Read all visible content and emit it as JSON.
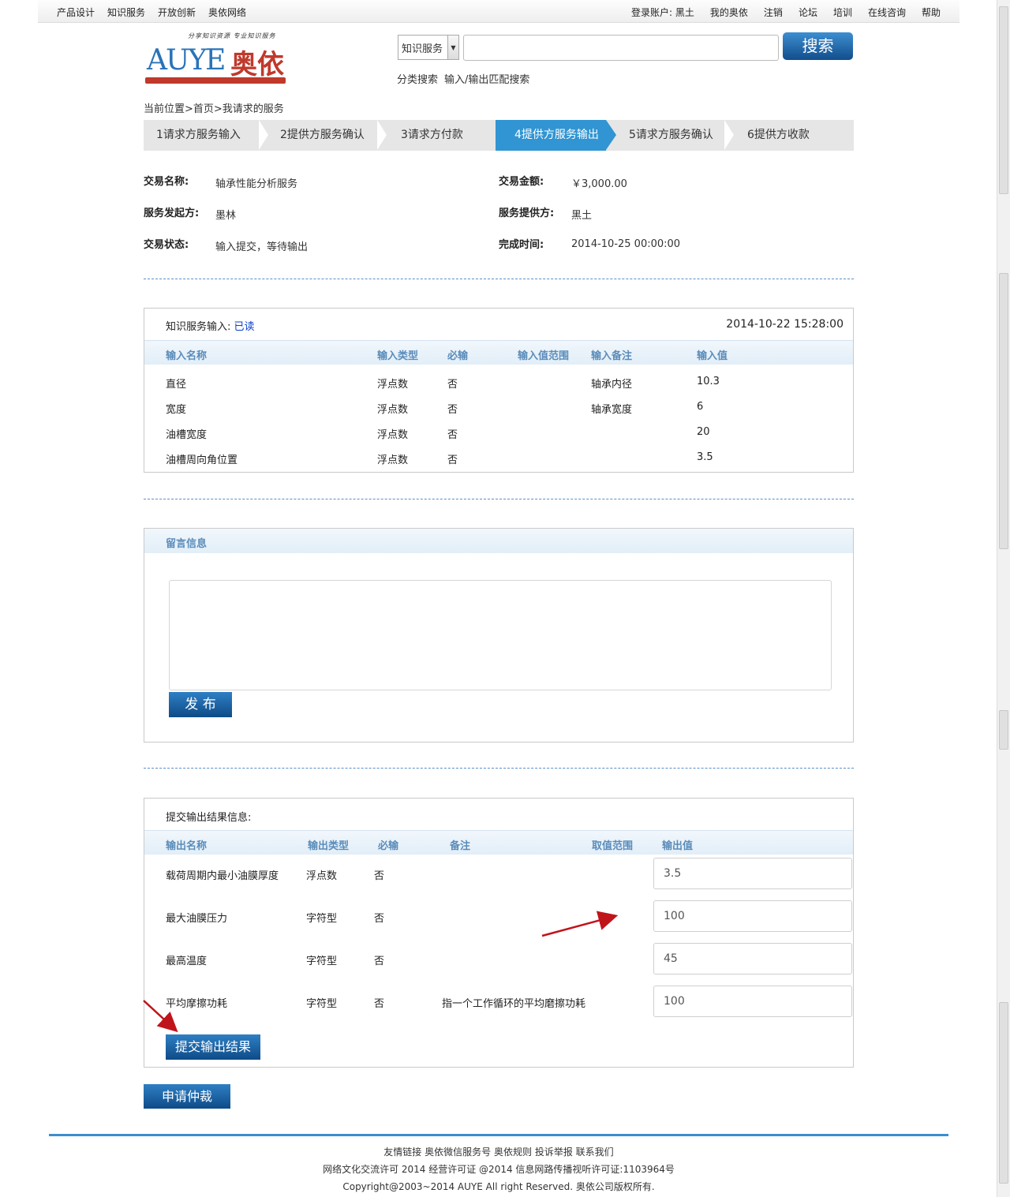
{
  "topnav": {
    "left": [
      "产品设计",
      "知识服务",
      "开放创新",
      "奥依网络"
    ],
    "account_label": "登录账户:",
    "account_name": "黑土",
    "right": [
      "我的奥依",
      "注销",
      "论坛",
      "培训",
      "在线咨询",
      "帮助"
    ]
  },
  "logo": {
    "tagline": "分享知识资源 专业知识服务",
    "brand": "AUYE",
    "brand_cn": "奥依"
  },
  "search": {
    "category": "知识服务",
    "button": "搜索",
    "links": [
      "分类搜索",
      "输入/输出匹配搜索"
    ]
  },
  "breadcrumb": "当前位置>首页>我请求的服务",
  "steps": [
    "1请求方服务输入",
    "2提供方服务确认",
    "3请求方付款",
    "4提供方服务输出",
    "5请求方服务确认",
    "6提供方收款"
  ],
  "active_step": 3,
  "transaction": {
    "name_label": "交易名称:",
    "name": "轴承性能分析服务",
    "amount_label": "交易金额:",
    "amount": "￥3,000.00",
    "initiator_label": "服务发起方:",
    "initiator": "墨林",
    "provider_label": "服务提供方:",
    "provider": "黑土",
    "status_label": "交易状态:",
    "status": "输入提交，等待输出",
    "finish_label": "完成时间:",
    "finish": "2014-10-25 00:00:00"
  },
  "input_panel": {
    "title": "知识服务输入:",
    "read_status": "已读",
    "timestamp": "2014-10-22 15:28:00",
    "columns": [
      "输入名称",
      "输入类型",
      "必输",
      "输入值范围",
      "输入备注",
      "输入值"
    ],
    "rows": [
      [
        "直径",
        "浮点数",
        "否",
        "",
        "轴承内径",
        "10.3"
      ],
      [
        "宽度",
        "浮点数",
        "否",
        "",
        "轴承宽度",
        "6"
      ],
      [
        "油槽宽度",
        "浮点数",
        "否",
        "",
        "",
        "20"
      ],
      [
        "油槽周向角位置",
        "浮点数",
        "否",
        "",
        "",
        "3.5"
      ]
    ]
  },
  "message_panel": {
    "title": "留言信息",
    "button": "发 布"
  },
  "output_panel": {
    "title": "提交输出结果信息:",
    "columns": [
      "输出名称",
      "输出类型",
      "必输",
      "备注",
      "取值范围",
      "输出值"
    ],
    "rows": [
      [
        "载荷周期内最小油膜厚度",
        "浮点数",
        "否",
        "",
        "",
        "3.5"
      ],
      [
        "最大油膜压力",
        "字符型",
        "否",
        "",
        "",
        "100"
      ],
      [
        "最高温度",
        "字符型",
        "否",
        "",
        "",
        "45"
      ],
      [
        "平均摩擦功耗",
        "字符型",
        "否",
        "指一个工作循环的平均磨擦功耗",
        "",
        "100"
      ]
    ],
    "submit_button": "提交输出结果"
  },
  "arbitration_button": "申请仲裁",
  "footer": {
    "links": [
      "友情链接",
      "奥依微信服务号",
      "奥依规则",
      "投诉举报",
      "联系我们"
    ],
    "line2": "网络文化交流许可 2014 经营许可证 @2014 信息网路传播视听许可证:1103964号",
    "line3": "Copyright@2003~2014 AUYE All right Reserved. 奥依公司版权所有."
  },
  "colors": {
    "accent": "#3195d3",
    "button": "#124d8c",
    "header_text": "#5a8cba",
    "read": "#0a3fd0"
  }
}
